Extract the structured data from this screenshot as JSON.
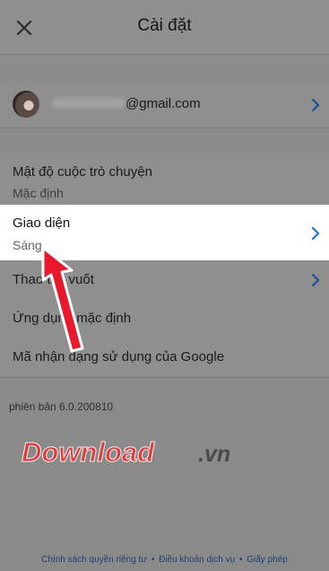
{
  "header": {
    "title": "Cài đặt",
    "close_icon": "close-icon"
  },
  "account": {
    "email_domain": "@gmail.com"
  },
  "settings": [
    {
      "label": "Mật độ cuộc trò chuyện",
      "value": "Mặc định"
    },
    {
      "label": "Giao diện",
      "value": "Sáng"
    },
    {
      "label": "Thao tác vuốt"
    },
    {
      "label": "Ứng dụng mặc định"
    },
    {
      "label": "Mã nhận dạng sử dụng của Google"
    }
  ],
  "version": "phiên bản 6.0.200810",
  "watermark": {
    "text_red": "Download",
    "text_dark": ".vn"
  },
  "footer": {
    "privacy": "Chính sách quyền riêng tư",
    "sep": "•",
    "terms": "Điều khoản dịch vụ",
    "license": "Giấy phép"
  },
  "colors": {
    "accent": "#1a73e8",
    "annotation_arrow": "#e8192c",
    "watermark_red": "#e03a3a"
  }
}
